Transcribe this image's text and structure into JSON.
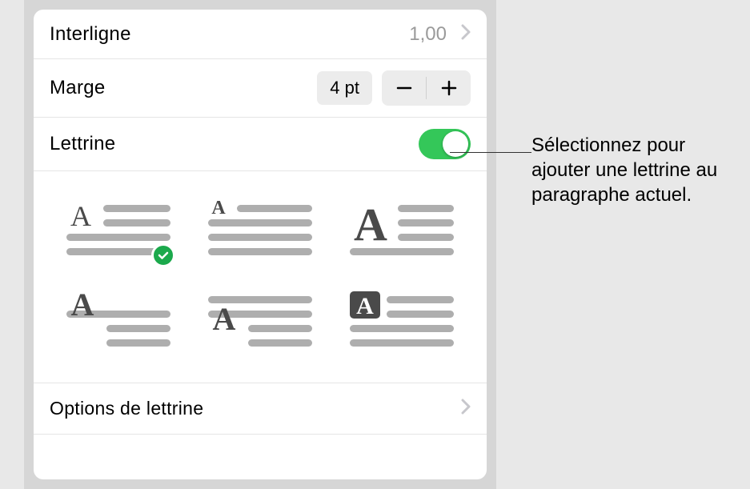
{
  "rows": {
    "interligne": {
      "label": "Interligne",
      "value": "1,00"
    },
    "marge": {
      "label": "Marge",
      "value": "4 pt"
    },
    "lettrine": {
      "label": "Lettrine"
    }
  },
  "options_row": {
    "label": "Options de lettrine"
  },
  "styles": {
    "selected": 0,
    "items": [
      {
        "name": "dropcap-small-wrap"
      },
      {
        "name": "dropcap-smaller-wrap"
      },
      {
        "name": "dropcap-large-wrap"
      },
      {
        "name": "dropcap-raised-inset"
      },
      {
        "name": "dropcap-baseline-inset"
      },
      {
        "name": "dropcap-boxed-inverse"
      }
    ]
  },
  "callout": "Sélectionnez pour ajouter une lettrine au paragraphe actuel.",
  "colors": {
    "accent": "#34c759",
    "check": "#1ba94c",
    "gray": "#aeaeae"
  }
}
